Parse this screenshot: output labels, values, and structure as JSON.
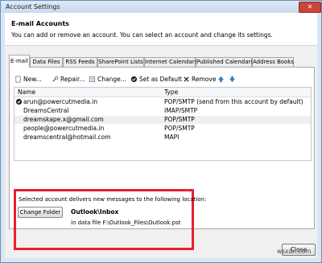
{
  "window": {
    "title": "Account Settings",
    "close_glyph": "✕"
  },
  "header": {
    "title": "E-mail Accounts",
    "description": "You can add or remove an account. You can select an account and change its settings."
  },
  "tabs": [
    "E-mail",
    "Data Files",
    "RSS Feeds",
    "SharePoint Lists",
    "Internet Calendars",
    "Published Calendars",
    "Address Books"
  ],
  "toolbar": {
    "new": "New...",
    "repair": "Repair...",
    "change": "Change...",
    "set_default": "Set as Default",
    "remove": "Remove"
  },
  "list": {
    "columns": {
      "name": "Name",
      "type": "Type"
    },
    "rows": [
      {
        "name": "arun@powercutmedia.in",
        "type": "POP/SMTP (send from this account by default)"
      },
      {
        "name": "DreamsCentral",
        "type": "IMAP/SMTP"
      },
      {
        "name": "dreamskape.x@gmail.com",
        "type": "POP/SMTP"
      },
      {
        "name": "people@powercutmedia.in",
        "type": "POP/SMTP"
      },
      {
        "name": "dreamscentral@hotmail.com",
        "type": "MAPI"
      }
    ]
  },
  "delivery": {
    "caption": "Selected account delivers new messages to the following location:",
    "change_folder": "Change Folder",
    "folder": "Outlook\\Inbox",
    "data_file": "in data file F:\\Outlook_Files\\Outlook.pst"
  },
  "footer": {
    "close": "Close"
  },
  "watermark": "wsxdn.com",
  "colors": {
    "highlight_border": "#e8202c",
    "title_bar": "#c9dbef",
    "close_button": "#c8453b"
  }
}
